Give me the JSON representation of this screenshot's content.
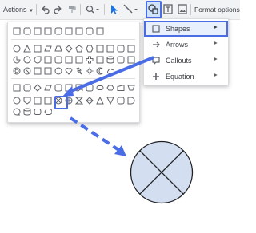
{
  "toolbar": {
    "actions_label": "Actions",
    "format_options_label": "Format options",
    "icons": [
      "undo-icon",
      "redo-icon",
      "paint-format-icon",
      "zoom-icon",
      "select-icon",
      "line-icon",
      "shape-icon",
      "text-box-icon",
      "image-icon"
    ]
  },
  "menu": {
    "items": [
      {
        "label": "Shapes",
        "icon": "square-icon",
        "active": true
      },
      {
        "label": "Arrows",
        "icon": "arrow-icon",
        "active": false
      },
      {
        "label": "Callouts",
        "icon": "callout-icon",
        "active": false
      },
      {
        "label": "Equation",
        "icon": "plus-icon",
        "active": false
      }
    ],
    "submenu_indicator": "►"
  },
  "shapes_grid": {
    "rows": [
      [
        "rectangle",
        "rounded-rectangle",
        "snip-single-corner",
        "snip-same-side",
        "snip-diagonal",
        "snip-round-single",
        "round-single-corner",
        "round-same-side",
        "round-diagonal"
      ],
      [
        "oval",
        "triangle",
        "right-triangle",
        "parallelogram",
        "trapezoid",
        "diamond",
        "pentagon",
        "hexagon",
        "heptagon",
        "octagon",
        "decagon",
        "dodecagon"
      ],
      [
        "pie",
        "chord",
        "teardrop",
        "frame",
        "half-frame",
        "corner",
        "diagonal-stripe",
        "cross",
        "plaque",
        "can",
        "cube",
        "bevel"
      ],
      [
        "donut",
        "no-symbol",
        "block-arc",
        "folded-corner",
        "smiley-face",
        "heart",
        "lightning-bolt",
        "sun",
        "moon",
        "cloud"
      ],
      [
        "flow-process",
        "flow-alternate-process",
        "flow-decision",
        "flow-data",
        "flow-predefined-process",
        "flow-internal-storage",
        "flow-document",
        "flow-multidocument",
        "flow-terminator",
        "flow-preparation",
        "flow-manual-input",
        "flow-manual-operation"
      ],
      [
        "flow-connector",
        "flow-offpage-connector",
        "flow-card",
        "flow-punched-tape",
        "flow-summing-junction",
        "flow-or",
        "flow-collate",
        "flow-sort",
        "flow-extract",
        "flow-merge",
        "flow-stored-data",
        "flow-delay"
      ],
      [
        "flow-sequential-access",
        "flow-magnetic-disk",
        "flow-direct-access",
        "flow-display"
      ]
    ],
    "selected": "flow-summing-junction"
  },
  "colors": {
    "accent": "#4a6de5",
    "shape_fill": "#d3dff1",
    "toolbar_bg": "#f1f3f4"
  },
  "canvas_shape": "flow-summing-junction"
}
